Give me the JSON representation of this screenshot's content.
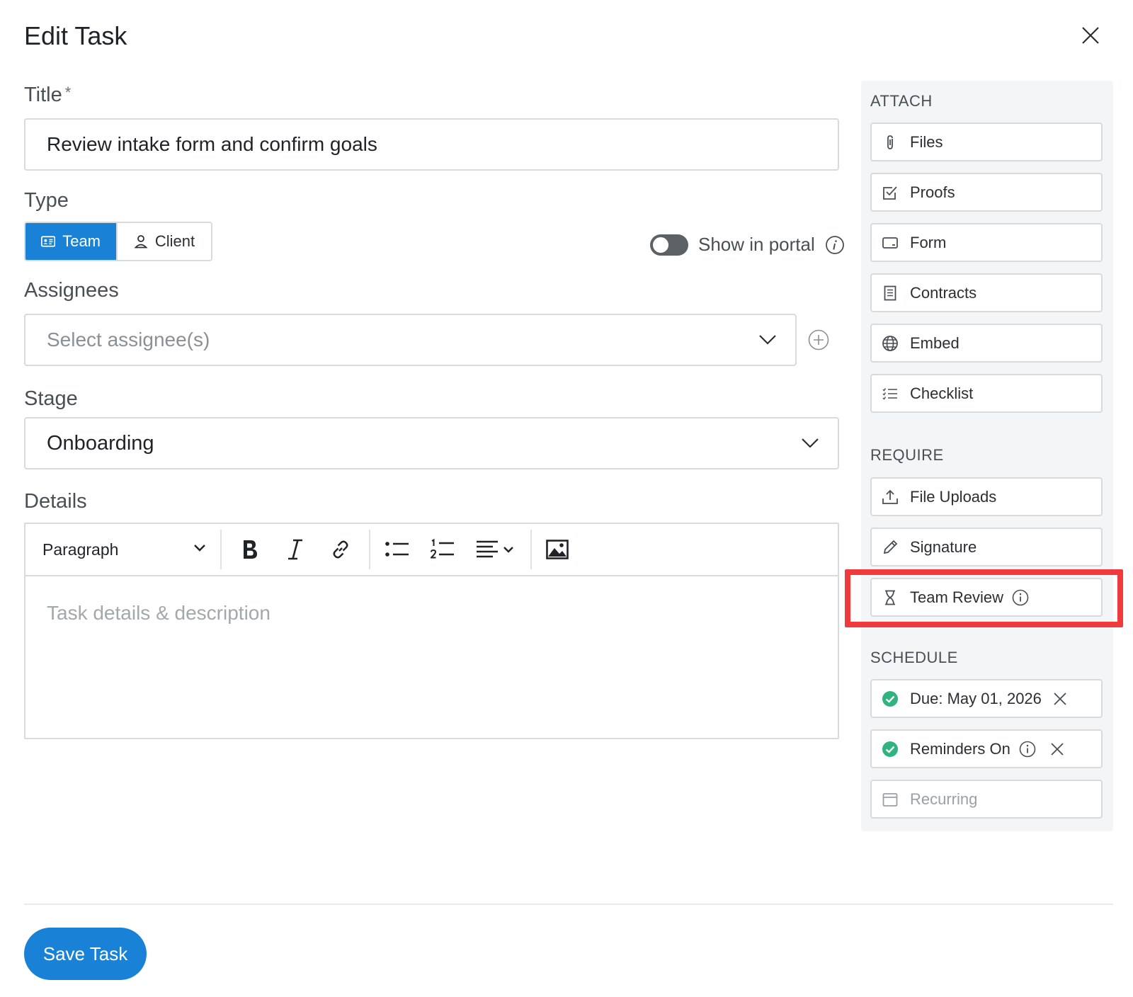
{
  "modal": {
    "title": "Edit Task"
  },
  "title_field": {
    "label": "Title",
    "required_mark": "*",
    "value": "Review intake form and confirm goals"
  },
  "type_field": {
    "label": "Type",
    "options": [
      {
        "label": "Team",
        "selected": true
      },
      {
        "label": "Client",
        "selected": false
      }
    ],
    "show_in_portal": {
      "label": "Show in portal",
      "on": false
    }
  },
  "assignees": {
    "label": "Assignees",
    "placeholder": "Select assignee(s)"
  },
  "stage": {
    "label": "Stage",
    "value": "Onboarding"
  },
  "details": {
    "label": "Details",
    "format_value": "Paragraph",
    "placeholder": "Task details & description"
  },
  "sidebar": {
    "attach": {
      "heading": "ATTACH",
      "items": [
        {
          "label": "Files",
          "icon": "paperclip-icon"
        },
        {
          "label": "Proofs",
          "icon": "checkbox-icon"
        },
        {
          "label": "Form",
          "icon": "form-icon"
        },
        {
          "label": "Contracts",
          "icon": "document-icon"
        },
        {
          "label": "Embed",
          "icon": "globe-icon"
        },
        {
          "label": "Checklist",
          "icon": "checklist-icon"
        }
      ]
    },
    "require": {
      "heading": "REQUIRE",
      "items": [
        {
          "label": "File Uploads",
          "icon": "upload-icon"
        },
        {
          "label": "Signature",
          "icon": "pen-icon"
        },
        {
          "label": "Team Review",
          "icon": "hourglass-icon"
        }
      ]
    },
    "schedule": {
      "heading": "SCHEDULE",
      "items": [
        {
          "label": "Due: May 01, 2026",
          "icon": "check-circle-icon"
        },
        {
          "label": "Reminders On",
          "icon": "check-circle-icon"
        },
        {
          "label": "Recurring",
          "icon": "calendar-icon"
        }
      ]
    }
  },
  "footer": {
    "save_label": "Save Task"
  },
  "colors": {
    "primary": "#1a82d6",
    "highlight": "#ef3b3b",
    "success": "#2fb380"
  }
}
